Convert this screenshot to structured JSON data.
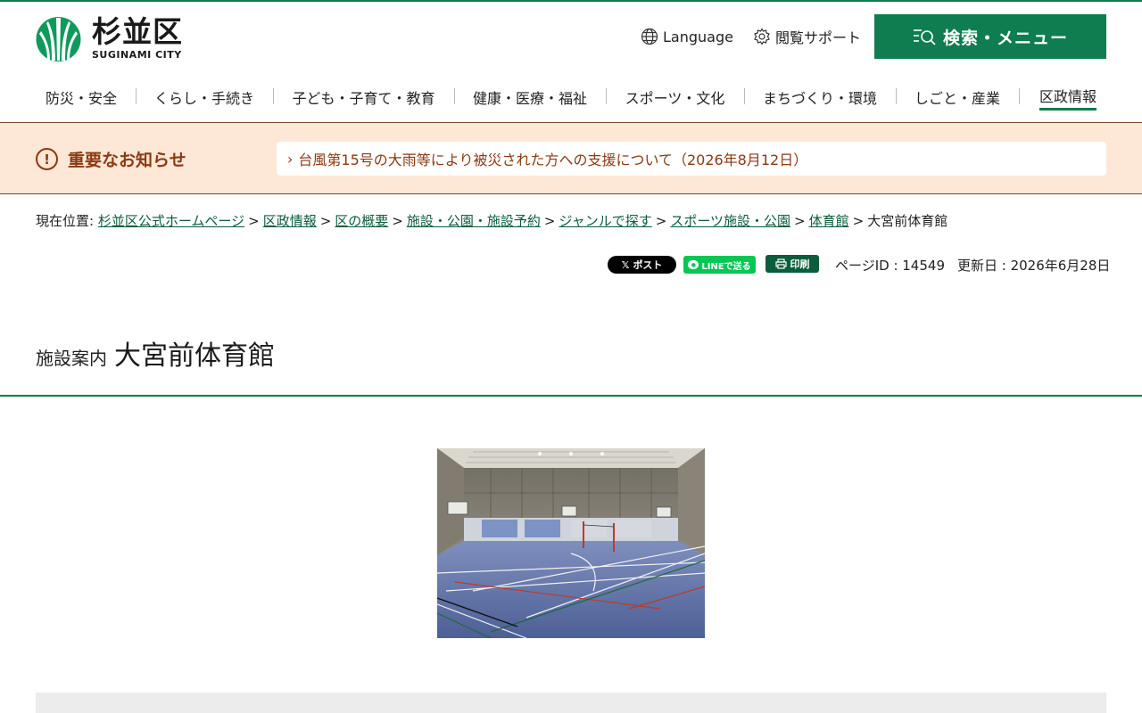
{
  "header": {
    "logo_name": "杉並区",
    "logo_sub": "SUGINAMI CITY",
    "language_label": "Language",
    "support_label": "閲覧サポート",
    "search_menu_label": "検索・メニュー"
  },
  "nav": {
    "items": [
      {
        "label": "防災・安全"
      },
      {
        "label": "くらし・手続き"
      },
      {
        "label": "子ども・子育て・教育"
      },
      {
        "label": "健康・医療・福祉"
      },
      {
        "label": "スポーツ・文化"
      },
      {
        "label": "まちづくり・環境"
      },
      {
        "label": "しごと・産業"
      },
      {
        "label": "区政情報",
        "active": true
      }
    ]
  },
  "notice": {
    "title": "重要なお知らせ",
    "item": "台風第15号の大雨等により被災された方への支援について（2026年8月12日）"
  },
  "breadcrumb": {
    "prefix": "現在位置:",
    "links": [
      "杉並区公式ホームページ",
      "区政情報",
      "区の概要",
      "施設・公園・施設予約",
      "ジャンルで探す",
      "スポーツ施設・公園",
      "体育館"
    ],
    "current": "大宮前体育館",
    "separator": ">"
  },
  "share": {
    "x_label": "ポスト",
    "line_label": "LINEで送る",
    "print_label": "印刷"
  },
  "meta": {
    "page_id": "ページID : 14549",
    "updated": "更新日 : 2026年6月28日"
  },
  "page": {
    "title_sub": "施設案内",
    "title_main": "大宮前体育館"
  },
  "colors": {
    "brand_green": "#0f7d4f",
    "notice_bg": "#fde7d6",
    "notice_text": "#8a3a12",
    "link": "#0b5d3b"
  }
}
